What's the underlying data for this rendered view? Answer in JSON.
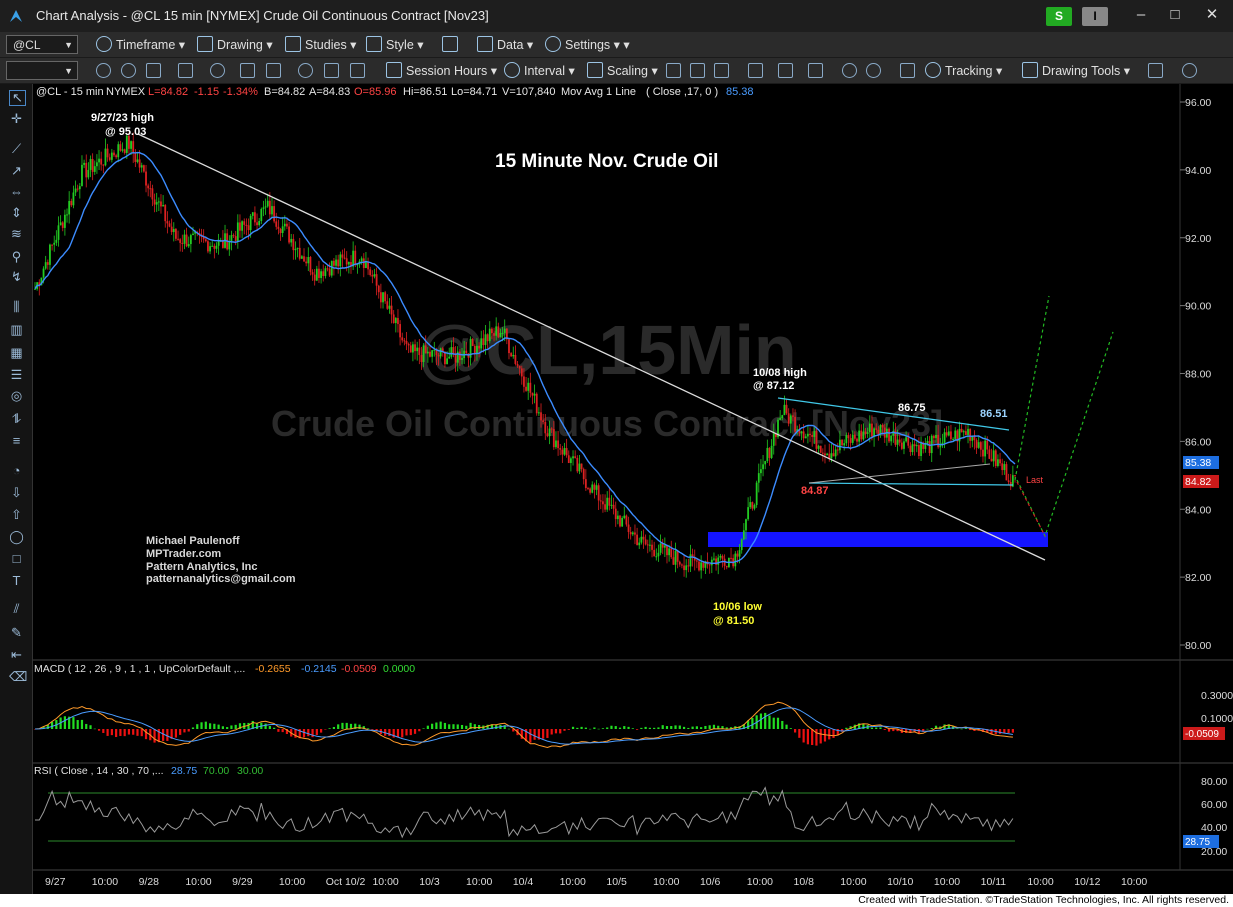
{
  "window": {
    "title": "Chart Analysis - @CL 15 min [NYMEX] Crude Oil Continuous Contract [Nov23]",
    "s_button": "S",
    "i_button": "I",
    "minimize": "–",
    "maximize": "□",
    "close": "✕"
  },
  "toolbar1": {
    "symbol": "@CL",
    "timeframe": "Timeframe",
    "drawing": "Drawing",
    "studies": "Studies",
    "style": "Style",
    "data": "Data",
    "settings": "Settings"
  },
  "toolbar2": {
    "session_hours": "Session Hours",
    "interval": "Interval",
    "scaling": "Scaling",
    "tracking": "Tracking",
    "drawing_tools": "Drawing Tools"
  },
  "price_header": {
    "symbol": "@CL - 15 min",
    "exchange": "NYMEX",
    "last": "L=84.82",
    "change": "-1.15",
    "pct": "-1.34%",
    "bid": "B=84.82",
    "ask": "A=84.83",
    "open": "O=85.96",
    "high": "Hi=86.51",
    "low": "Lo=84.71",
    "volume": "V=107,840",
    "ma_label": "Mov Avg 1 Line",
    "ma_params": "( Close ,17,  0 )",
    "ma_value": "85.38"
  },
  "watermark": {
    "line1": "@CL,15Min",
    "line2": "Crude Oil Continuous Contract [Nov23]"
  },
  "annotations": {
    "chart_title": "15 Minute Nov. Crude Oil",
    "high_label_1": "9/27/23 high",
    "high_label_2": "@ 95.03",
    "oct8_label_1": "10/08 high",
    "oct8_label_2": "@ 87.12",
    "low_label_1": "10/06 low",
    "low_label_2": "@ 81.50",
    "level_8675": "86.75",
    "level_8651": "86.51",
    "level_8487": "84.87",
    "last_tag": "Last",
    "credit_1": "Michael Paulenoff",
    "credit_2": "MPTrader.com",
    "credit_3": "Pattern Analytics, Inc",
    "credit_4": "patternanalytics@gmail.com"
  },
  "price_axis": {
    "ticks": [
      "96.00",
      "94.00",
      "92.00",
      "90.00",
      "88.00",
      "86.00",
      "84.00",
      "82.00",
      "80.00"
    ],
    "ma_tag": "85.38",
    "last_tag": "84.82"
  },
  "macd": {
    "label": "MACD ( 12 , 26 , 9 , 1 , 1 , UpColorDefault ,...",
    "v1": "-0.2655",
    "v2": "-0.2145",
    "v3": "-0.0509",
    "v4": "0.0000",
    "ticks": [
      "0.3000",
      "0.1000"
    ],
    "tag": "-0.0509"
  },
  "rsi": {
    "label": "RSI ( Close , 14 , 30 , 70 ,...",
    "v1": "28.75",
    "v2": "70.00",
    "v3": "30.00",
    "ticks": [
      "80.00",
      "60.00",
      "40.00",
      "20.00"
    ],
    "tag": "28.75"
  },
  "time_axis": {
    "labels": [
      "9/27",
      "10:00",
      "9/28",
      "10:00",
      "9/29",
      "10:00",
      "Oct 10/2",
      "10:00",
      "10/3",
      "10:00",
      "10/4",
      "10:00",
      "10/5",
      "10:00",
      "10/6",
      "10:00",
      "10/8",
      "10:00",
      "10/10",
      "10:00",
      "10/11",
      "10:00",
      "10/12",
      "10:00"
    ]
  },
  "status": {
    "text": "Created with TradeStation. ©TradeStation Technologies, Inc. All rights reserved."
  },
  "colors": {
    "up_candle": "#22cc22",
    "down_candle": "#dd2222",
    "ma_line": "#3c8cff",
    "zone": "#1414ff",
    "triangle": "#40c8e8",
    "projection": "#22bb22"
  },
  "chart_data": {
    "type": "line",
    "price_scale": [
      80,
      96
    ],
    "swing_path_x": [
      "9/27",
      "9/27 10:00",
      "9/28",
      "9/28 10:00",
      "9/29",
      "9/29 10:00",
      "10/2",
      "10/2 10:00",
      "10/3",
      "10/3 10:00",
      "10/4",
      "10/4 10:00",
      "10/5",
      "10/5 10:00",
      "10/6",
      "10/6 10:00",
      "10/8",
      "10/8 10:00",
      "10/10",
      "10/10 10:00",
      "10/11",
      "10/11 10:00"
    ],
    "swing_path_y": [
      90.5,
      93.9,
      94.8,
      92.0,
      91.8,
      92.9,
      91.0,
      91.5,
      88.6,
      88.5,
      89.3,
      86.3,
      84.5,
      83.0,
      82.4,
      82.6,
      86.9,
      85.7,
      86.4,
      85.8,
      86.3,
      84.8
    ],
    "key_levels": {
      "high_9_27": 95.03,
      "high_10_08": 87.12,
      "low_10_06": 81.5,
      "resistance": 86.75,
      "recent_high": 86.51,
      "support": 84.87,
      "last": 84.82,
      "ma": 85.38
    },
    "support_zone": [
      82.9,
      83.3
    ]
  }
}
